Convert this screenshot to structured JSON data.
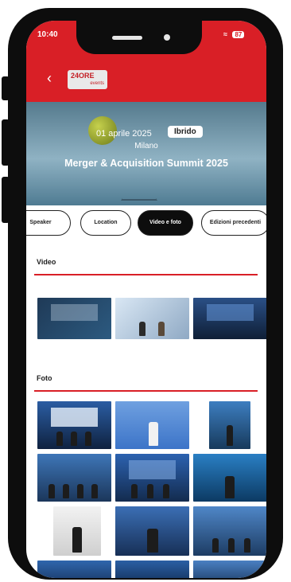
{
  "status": {
    "time": "10:40",
    "battery": "87"
  },
  "header": {
    "logo_top": "24ORE",
    "logo_bottom": "events"
  },
  "event": {
    "date": "01 aprile 2025",
    "mode_badge": "Ibrido",
    "city": "Milano",
    "title": "Merger & Acquisition Summit 2025"
  },
  "tabs": [
    {
      "label": "Speaker",
      "active": false
    },
    {
      "label": "Location",
      "active": false
    },
    {
      "label": "Video e foto",
      "active": true
    },
    {
      "label": "Edizioni precedenti",
      "active": false
    }
  ],
  "sections": {
    "video_title": "Video",
    "photo_title": "Foto"
  },
  "colors": {
    "accent": "#d91f26",
    "dark": "#0d0d0d"
  },
  "icons": {
    "back": "chevron-left-icon"
  }
}
